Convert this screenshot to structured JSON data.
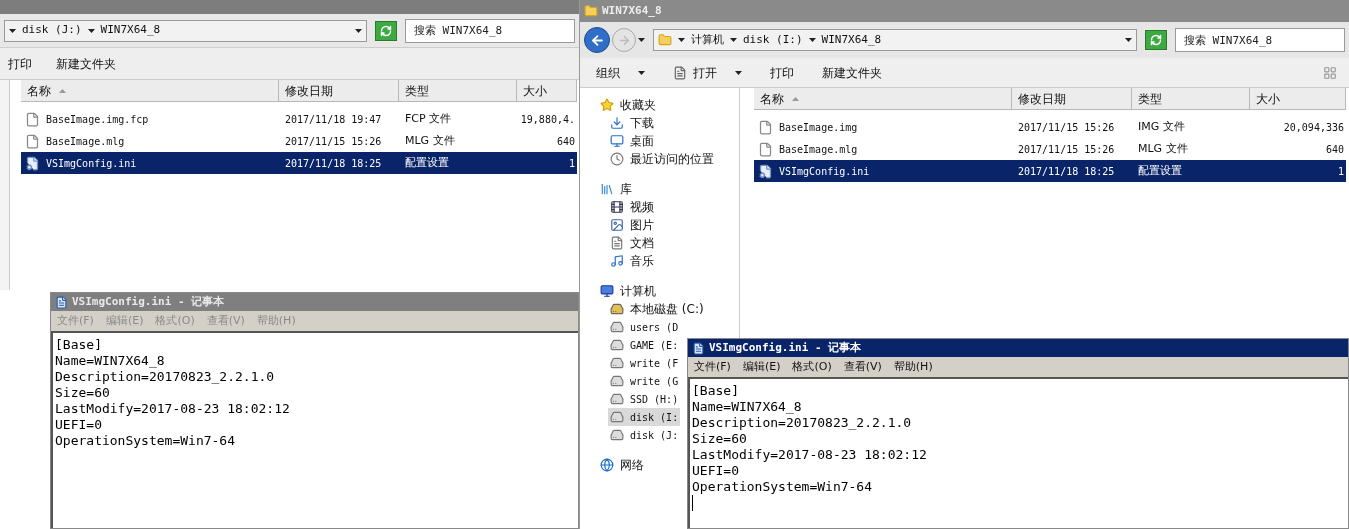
{
  "left_explorer": {
    "address": [
      "disk (J:)",
      "WIN7X64_8"
    ],
    "search": {
      "placeholder": "搜索 WIN7X64_8"
    },
    "toolbar": [
      {
        "label": "打印",
        "dropdown": false
      },
      {
        "label": "新建文件夹",
        "dropdown": false
      }
    ],
    "columns": [
      "名称",
      "修改日期",
      "类型",
      "大小"
    ],
    "files": [
      {
        "name": "BaseImage.img.fcp",
        "modified": "2017/11/18 19:47",
        "type": "FCP 文件",
        "size": "19,880,4.",
        "kind": "file",
        "selected": false
      },
      {
        "name": "BaseImage.mlg",
        "modified": "2017/11/15 15:26",
        "type": "MLG 文件",
        "size": "640",
        "kind": "file",
        "selected": false
      },
      {
        "name": "VSImgConfig.ini",
        "modified": "2017/11/18 18:25",
        "type": "配置设置",
        "size": "1",
        "kind": "config",
        "selected": true
      }
    ]
  },
  "left_notepad": {
    "title": "VSImgConfig.ini - 记事本",
    "active": false,
    "menu": [
      "文件(F)",
      "编辑(E)",
      "格式(O)",
      "查看(V)",
      "帮助(H)"
    ],
    "lines": [
      "[Base]",
      "Name=WIN7X64_8",
      "Description=20170823_2.2.1.0",
      "Size=60",
      "LastModify=2017-08-23 18:02:12",
      "UEFI=0",
      "OperationSystem=Win7-64"
    ]
  },
  "right_explorer": {
    "title": "WIN7X64_8",
    "address": [
      "计算机",
      "disk (I:)",
      "WIN7X64_8"
    ],
    "search": {
      "placeholder": "搜索 WIN7X64_8"
    },
    "toolbar": [
      {
        "label": "组织",
        "kind": "command",
        "dropdown": true
      },
      {
        "label": "打开",
        "kind": "open",
        "dropdown": true
      },
      {
        "label": "打印",
        "kind": "command",
        "dropdown": false
      },
      {
        "label": "新建文件夹",
        "kind": "command",
        "dropdown": false
      }
    ],
    "nav": [
      {
        "label": "收藏夹",
        "kind": "star",
        "selected": false,
        "children": [
          {
            "label": "下载",
            "kind": "download",
            "selected": false
          },
          {
            "label": "桌面",
            "kind": "desktop",
            "selected": false
          },
          {
            "label": "最近访问的位置",
            "kind": "recent",
            "selected": false
          }
        ]
      },
      {
        "label": "库",
        "kind": "library",
        "selected": false,
        "children": [
          {
            "label": "视频",
            "kind": "video",
            "selected": false
          },
          {
            "label": "图片",
            "kind": "picture",
            "selected": false
          },
          {
            "label": "文档",
            "kind": "document",
            "selected": false
          },
          {
            "label": "音乐",
            "kind": "music",
            "selected": false
          }
        ]
      },
      {
        "label": "计算机",
        "kind": "computer",
        "selected": false,
        "children": [
          {
            "label": "本地磁盘 (C:)",
            "kind": "system-drive",
            "selected": false
          },
          {
            "label": "users (D",
            "kind": "drive",
            "selected": false
          },
          {
            "label": "GAME (E:",
            "kind": "drive",
            "selected": false
          },
          {
            "label": "write (F",
            "kind": "drive",
            "selected": false
          },
          {
            "label": "write (G",
            "kind": "drive",
            "selected": false
          },
          {
            "label": "SSD (H:)",
            "kind": "drive",
            "selected": false
          },
          {
            "label": "disk (I:",
            "kind": "drive",
            "selected": true
          },
          {
            "label": "disk (J:",
            "kind": "drive",
            "selected": false
          }
        ]
      },
      {
        "label": "网络",
        "kind": "network",
        "selected": false
      }
    ],
    "columns": [
      "名称",
      "修改日期",
      "类型",
      "大小"
    ],
    "files": [
      {
        "name": "BaseImage.img",
        "modified": "2017/11/15 15:26",
        "type": "IMG 文件",
        "size": "20,094,336",
        "kind": "file",
        "selected": false
      },
      {
        "name": "BaseImage.mlg",
        "modified": "2017/11/15 15:26",
        "type": "MLG 文件",
        "size": "640",
        "kind": "file",
        "selected": false
      },
      {
        "name": "VSImgConfig.ini",
        "modified": "2017/11/18 18:25",
        "type": "配置设置",
        "size": "1",
        "kind": "config",
        "selected": true
      }
    ]
  },
  "right_notepad": {
    "title": "VSImgConfig.ini - 记事本",
    "active": true,
    "menu": [
      "文件(F)",
      "编辑(E)",
      "格式(O)",
      "查看(V)",
      "帮助(H)"
    ],
    "lines": [
      "[Base]",
      "Name=WIN7X64_8",
      "Description=20170823_2.2.1.0",
      "Size=60",
      "LastModify=2017-08-23 18:02:12",
      "UEFI=0",
      "OperationSystem=Win7-64"
    ],
    "cursor": true
  }
}
